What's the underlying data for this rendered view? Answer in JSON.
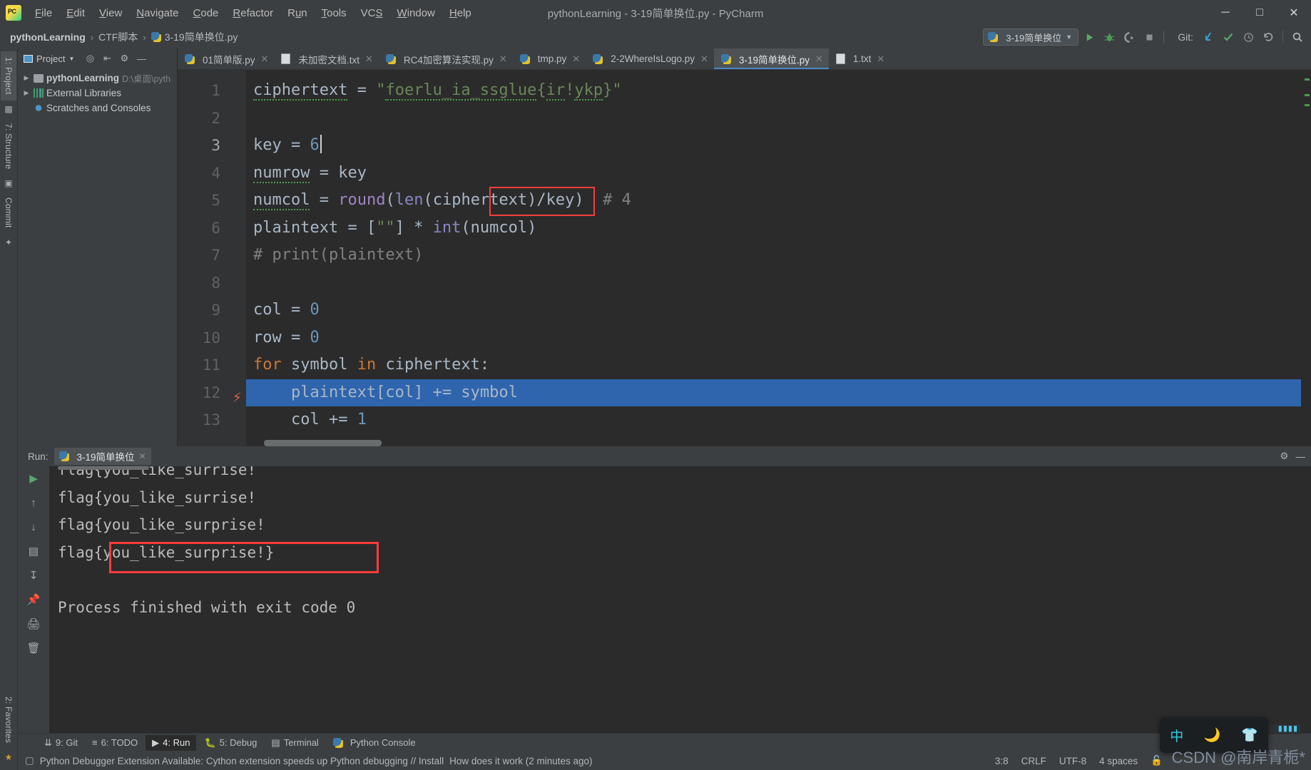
{
  "window": {
    "title": "pythonLearning - 3-19简单换位.py - PyCharm",
    "logo_icon": "pycharm-logo-icon",
    "minimize_icon": "minimize-icon",
    "maximize_icon": "maximize-icon",
    "close_icon": "close-icon"
  },
  "menubar": {
    "items": [
      {
        "label": "File",
        "mnemonic": "F"
      },
      {
        "label": "Edit",
        "mnemonic": "E"
      },
      {
        "label": "View",
        "mnemonic": "V"
      },
      {
        "label": "Navigate",
        "mnemonic": "N"
      },
      {
        "label": "Code",
        "mnemonic": "C"
      },
      {
        "label": "Refactor",
        "mnemonic": "R"
      },
      {
        "label": "Run",
        "mnemonic": "u"
      },
      {
        "label": "Tools",
        "mnemonic": "T"
      },
      {
        "label": "VCS",
        "mnemonic": "S"
      },
      {
        "label": "Window",
        "mnemonic": "W"
      },
      {
        "label": "Help",
        "mnemonic": "H"
      }
    ]
  },
  "breadcrumb": {
    "project": "pythonLearning",
    "folder": "CTF脚本",
    "file": "3-19简单换位.py",
    "separator": "›"
  },
  "toolbar": {
    "run_config": "3-19简单换位",
    "run_config_dropdown_icon": "chevron-down-icon",
    "run_icon": "run-icon",
    "debug_icon": "debug-icon",
    "coverage_icon": "run-with-coverage-icon",
    "stop_icon": "stop-icon",
    "git_label": "Git:",
    "update_icon": "git-update-icon",
    "commit_icon": "git-commit-icon",
    "history_icon": "git-history-icon",
    "rollback_icon": "git-rollback-icon",
    "search_icon": "search-everywhere-icon"
  },
  "left_rail": {
    "project_tab": "1: Project",
    "structure_tab": "7: Structure",
    "commit_tab": "Commit",
    "favorites_tab": "2: Favorites"
  },
  "project_panel": {
    "title": "Project",
    "title_dropdown_icon": "chevron-down-icon",
    "locate_icon": "locate-file-icon",
    "collapse_icon": "collapse-all-icon",
    "settings_icon": "gear-icon",
    "hide_icon": "hide-icon",
    "tree": [
      {
        "label": "pythonLearning",
        "path": "D:\\桌面\\pyth",
        "icon": "folder-icon",
        "expandable": true,
        "bold": true
      },
      {
        "label": "External Libraries",
        "path": "",
        "icon": "library-icon",
        "expandable": true,
        "bold": false
      },
      {
        "label": "Scratches and Consoles",
        "path": "",
        "icon": "scratches-icon",
        "expandable": false,
        "bold": false
      }
    ]
  },
  "editor_tabs": [
    {
      "label": "01简单版.py",
      "icon": "python-file-icon",
      "active": false
    },
    {
      "label": "未加密文档.txt",
      "icon": "text-file-icon",
      "active": false
    },
    {
      "label": "RC4加密算法实现.py",
      "icon": "python-file-icon",
      "active": false
    },
    {
      "label": "tmp.py",
      "icon": "python-file-icon",
      "active": false
    },
    {
      "label": "2-2WhereIsLogo.py",
      "icon": "python-file-icon",
      "active": false
    },
    {
      "label": "3-19简单换位.py",
      "icon": "python-file-icon",
      "active": true
    },
    {
      "label": "1.txt",
      "icon": "text-file-icon",
      "active": false
    }
  ],
  "editor": {
    "line_numbers": [
      "1",
      "2",
      "3",
      "4",
      "5",
      "6",
      "7",
      "8",
      "9",
      "10",
      "11",
      "12",
      "13"
    ],
    "highlighted_line": 12,
    "breakpoint_line": 12,
    "breakpoint_icon": "lightning-bolt-icon",
    "caret_line": 3,
    "lines": [
      {
        "n": 1,
        "text": "ciphertext = \"foerlu_ia_ssglue{ir!ykp}\""
      },
      {
        "n": 2,
        "text": ""
      },
      {
        "n": 3,
        "text": "key = 6"
      },
      {
        "n": 4,
        "text": "numrow = key"
      },
      {
        "n": 5,
        "text": "numcol = round(len(ciphertext)/key)  # 4"
      },
      {
        "n": 6,
        "text": "plaintext = [\"\"] * int(numcol)"
      },
      {
        "n": 7,
        "text": "# print(plaintext)"
      },
      {
        "n": 8,
        "text": ""
      },
      {
        "n": 9,
        "text": "col = 0"
      },
      {
        "n": 10,
        "text": "row = 0"
      },
      {
        "n": 11,
        "text": "for symbol in ciphertext:"
      },
      {
        "n": 12,
        "text": "    plaintext[col] += symbol"
      },
      {
        "n": 13,
        "text": "    col += 1"
      }
    ],
    "annotation_box_color": "#fa3c3c"
  },
  "run_window": {
    "label": "Run:",
    "tab_label": "3-19简单换位",
    "tab_icon": "python-file-icon",
    "close_icon": "close-icon",
    "settings_icon": "gear-icon",
    "hide_icon": "hide-icon",
    "rerun_icon": "rerun-icon",
    "up_icon": "up-arrow-icon",
    "down_icon": "down-arrow-icon",
    "stop_icon": "stop-icon",
    "wrap_icon": "soft-wrap-icon",
    "scroll_end_icon": "scroll-to-end-icon",
    "pin_icon": "pin-icon",
    "print_icon": "print-icon",
    "trash_icon": "clear-all-icon",
    "output": [
      "flag{you_like_surrise!",
      "flag{you_like_surrise!",
      "flag{you_like_surprise!",
      "flag{you_like_surprise!}",
      "",
      "Process finished with exit code 0"
    ],
    "highlighted_output_index": 3
  },
  "bottom_tabs": [
    {
      "label": "9: Git",
      "mnemonic": "9",
      "icon": "git-branch-icon",
      "active": false
    },
    {
      "label": "6: TODO",
      "mnemonic": "6",
      "icon": "todo-icon",
      "active": false
    },
    {
      "label": "4: Run",
      "mnemonic": "4",
      "icon": "run-icon",
      "active": true
    },
    {
      "label": "5: Debug",
      "mnemonic": "5",
      "icon": "debug-icon",
      "active": false
    },
    {
      "label": "Terminal",
      "mnemonic": "",
      "icon": "terminal-icon",
      "active": false
    },
    {
      "label": "Python Console",
      "mnemonic": "",
      "icon": "python-console-icon",
      "active": false
    }
  ],
  "statusbar": {
    "message_icon": "notification-icon",
    "message": "Python Debugger Extension Available: Cython extension speeds up Python debugging // Install",
    "message_time": "How does it work (2 minutes ago)",
    "caret_position": "3:8",
    "line_separator": "CRLF",
    "encoding": "UTF-8",
    "indent": "4 spaces",
    "lock_icon": "unlocked-icon",
    "interpreter_icon": "python-interpreter-icon"
  },
  "ime_popup": {
    "mode": "中",
    "moon_icon": "moon-icon",
    "shirt_icon": "shirt-icon"
  },
  "watermark": "CSDN @南岸青栀*"
}
